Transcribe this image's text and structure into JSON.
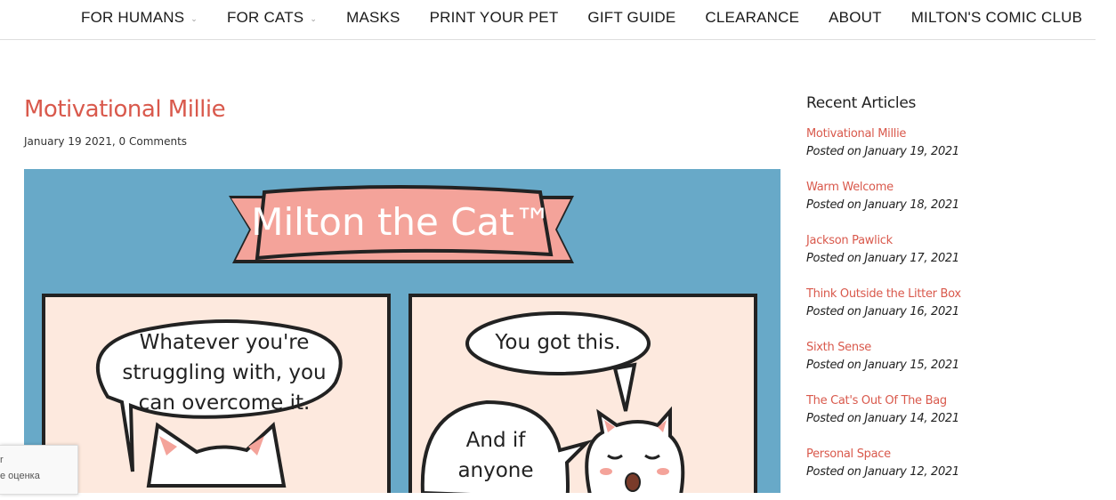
{
  "nav": {
    "items": [
      {
        "label": "FOR HUMANS",
        "dropdown": true
      },
      {
        "label": "FOR CATS",
        "dropdown": true
      },
      {
        "label": "MASKS",
        "dropdown": false
      },
      {
        "label": "PRINT YOUR PET",
        "dropdown": false
      },
      {
        "label": "GIFT GUIDE",
        "dropdown": false
      },
      {
        "label": "CLEARANCE",
        "dropdown": false
      },
      {
        "label": "ABOUT",
        "dropdown": false
      },
      {
        "label": "MILTON'S COMIC CLUB",
        "dropdown": false
      }
    ]
  },
  "post": {
    "title": "Motivational Millie",
    "meta": "January 19 2021, 0 Comments"
  },
  "comic": {
    "banner": "Milton the Cat™",
    "panel1_line1": "Whatever you're",
    "panel1_line2": "struggling with, you",
    "panel1_line3": "can overcome it.",
    "panel2_bubble": "You got this.",
    "panel2_line1": "And if",
    "panel2_line2": "anyone"
  },
  "sidebar": {
    "heading": "Recent Articles",
    "articles": [
      {
        "title": "Motivational Millie",
        "date": "Posted on January 19, 2021"
      },
      {
        "title": "Warm Welcome",
        "date": "Posted on January 18, 2021"
      },
      {
        "title": "Jackson Pawlick",
        "date": "Posted on January 17, 2021"
      },
      {
        "title": "Think Outside the Litter Box",
        "date": "Posted on January 16, 2021"
      },
      {
        "title": "Sixth Sense",
        "date": "Posted on January 15, 2021"
      },
      {
        "title": "The Cat's Out Of The Bag",
        "date": "Posted on January 14, 2021"
      },
      {
        "title": "Personal Space",
        "date": "Posted on January 12, 2021"
      }
    ]
  },
  "recaptcha": {
    "line1": "r",
    "line2": "е оценка"
  },
  "colors": {
    "accent": "#d9594c",
    "comic_bg": "#68a9c8",
    "banner": "#f4a39a",
    "panel": "#fde9de"
  }
}
